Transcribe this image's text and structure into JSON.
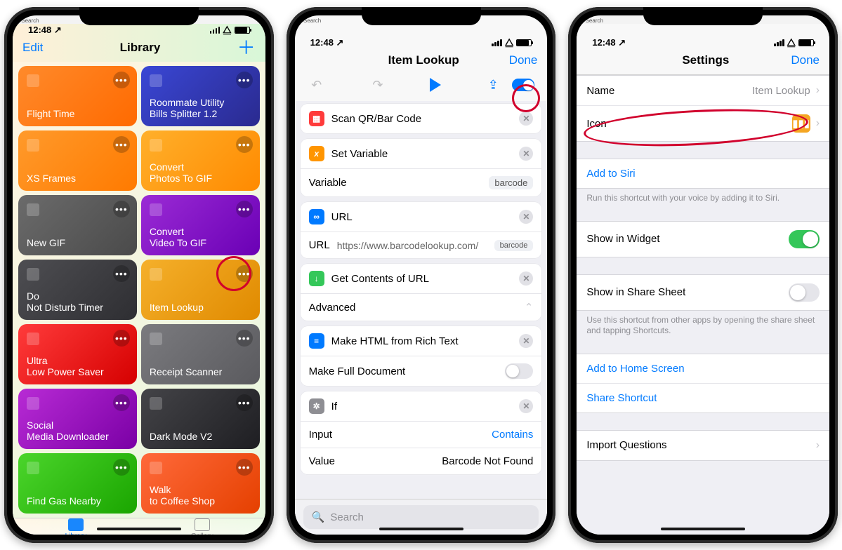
{
  "status": {
    "time": "12:48",
    "back_hint": "◂ Search"
  },
  "p1": {
    "nav": {
      "left": "Edit",
      "title": "Library",
      "right": "＋"
    },
    "tiles": [
      {
        "label": "Flight Time",
        "bg": "linear-gradient(135deg,#ff8a2b,#ff6a00)",
        "icon": "airplane-icon"
      },
      {
        "label": "Roommate Utility\nBills Splitter 1.2",
        "bg": "linear-gradient(135deg,#3a47d5,#2a2a8f)",
        "icon": "dollar-icon"
      },
      {
        "label": "XS Frames",
        "bg": "linear-gradient(135deg,#ff9a2b,#ff7a00)",
        "icon": "phone-icon"
      },
      {
        "label": "Convert\nPhotos To GIF",
        "bg": "linear-gradient(135deg,#ffb02b,#ff8a00)",
        "icon": "grid-icon"
      },
      {
        "label": "New GIF",
        "bg": "linear-gradient(135deg,#6b6b6b,#4a4a4a)",
        "icon": "target-icon"
      },
      {
        "label": "Convert\nVideo To GIF",
        "bg": "linear-gradient(135deg,#9b2bd5,#6a00b5)",
        "icon": "video-icon"
      },
      {
        "label": "Do\nNot Disturb Timer",
        "bg": "linear-gradient(135deg,#4e4e52,#2e2e32)",
        "icon": "moon-icon"
      },
      {
        "label": "Item Lookup",
        "bg": "linear-gradient(135deg,#f5b02b,#e08a00)",
        "icon": "barcode-icon"
      },
      {
        "label": "Ultra\nLow Power Saver",
        "bg": "linear-gradient(135deg,#ff3b3b,#d50000)",
        "icon": "infinity-icon"
      },
      {
        "label": "Receipt Scanner",
        "bg": "linear-gradient(135deg,#7b7b7f,#5a5a5e)",
        "icon": "document-icon"
      },
      {
        "label": "Social\nMedia Downloader",
        "bg": "linear-gradient(135deg,#b82bd5,#7a00a5)",
        "icon": "download-icon"
      },
      {
        "label": "Dark Mode V2",
        "bg": "linear-gradient(135deg,#444448,#1e1e22)",
        "icon": "wand-icon"
      },
      {
        "label": "Find Gas Nearby",
        "bg": "linear-gradient(135deg,#4bd52b,#1aa500)",
        "icon": "car-icon"
      },
      {
        "label": "Walk\nto Coffee Shop",
        "bg": "linear-gradient(135deg,#ff6a3b,#e54000)",
        "icon": "cup-icon"
      }
    ],
    "tabs": {
      "library": "Library",
      "gallery": "Gallery"
    }
  },
  "p2": {
    "nav": {
      "title": "Item Lookup",
      "done": "Done"
    },
    "a_scan": "Scan QR/Bar Code",
    "a_setvar": "Set Variable",
    "a_var_label": "Variable",
    "a_var_value": "barcode",
    "a_url": "URL",
    "a_url_label": "URL",
    "a_url_value": "https://www.barcodelookup.com/",
    "a_url_token": "barcode",
    "a_get": "Get Contents of URL",
    "a_adv": "Advanced",
    "a_html": "Make HTML from Rich Text",
    "a_full": "Make Full Document",
    "a_if": "If",
    "a_input": "Input",
    "a_contains": "Contains",
    "a_value": "Value",
    "a_value_v": "Barcode Not Found",
    "search_ph": "Search"
  },
  "p3": {
    "nav": {
      "title": "Settings",
      "done": "Done"
    },
    "name_l": "Name",
    "name_v": "Item Lookup",
    "icon_l": "Icon",
    "siri": "Add to Siri",
    "siri_note": "Run this shortcut with your voice by adding it to Siri.",
    "widget": "Show in Widget",
    "sheet": "Show in Share Sheet",
    "sheet_note": "Use this shortcut from other apps by opening the share sheet and tapping Shortcuts.",
    "home": "Add to Home Screen",
    "share": "Share Shortcut",
    "import": "Import Questions"
  }
}
